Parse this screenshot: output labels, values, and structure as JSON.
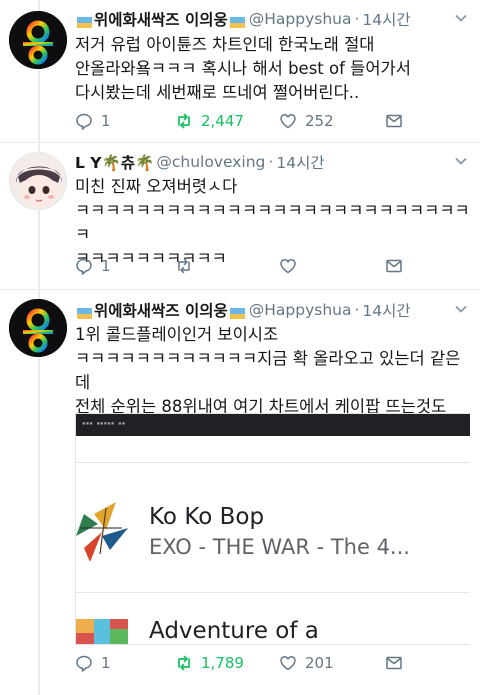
{
  "tweets": [
    {
      "display_name": "위에화새싹즈 이의웅",
      "handle": "@Happyshua",
      "time": "14시간",
      "dot": "·",
      "text": "저거 유럽 아이튠즈 차트인데 한국노래 절대\n안올라와욬ㅋㅋㅋ 혹시나 해서 best of 들어가서\n다시봤는데 세번째로 뜨네여 쩔어버린다..",
      "replies": "1",
      "retweets": "2,447",
      "likes": "252",
      "retweeted": true
    },
    {
      "display_name": "L Y🌴츄🌴",
      "handle": "@chulovexing",
      "time": "14시간",
      "dot": "·",
      "text": "미친 진짜 오져버렷ㅅ다\nㅋㅋㅋㅋㅋㅋㅋㅋㅋㅋㅋㅋㅋㅋㅋㅋㅋㅋㅋㅋㅋㅋㅋㅋㅋㅋㅋ\nㅋㅋㅋㅋㅋㅋㅋㅋㅋㅋ",
      "replies": "1",
      "retweets": "",
      "likes": "",
      "retweeted": false
    },
    {
      "display_name": "위에화새싹즈 이의웅",
      "handle": "@Happyshua",
      "time": "14시간",
      "dot": "·",
      "text": "1위 콜드플레이인거 보이시조\nㅋㅋㅋㅋㅋㅋㅋㅋㅋㅋㅋㅋ지금 확 올라오고 있는더 같은데\n전체 순위는 88위내여 여기 차트에서 케이팝 뜨는것도\n렬루첨봐욜ㅋㅋ",
      "replies": "1",
      "retweets": "1,789",
      "likes": "201",
      "retweeted": true,
      "card": {
        "song_title": "Ko Ko Bop",
        "song_subtitle": "EXO - THE WAR - The 4...",
        "next_title": "Adventure of a"
      }
    }
  ],
  "colors": {
    "retweet_active": "#17bf63",
    "icon_gray": "#657786",
    "divider": "#e6ecf0"
  },
  "icons": [
    "reply-icon",
    "retweet-icon",
    "like-icon",
    "message-icon",
    "chevron-down-icon"
  ]
}
